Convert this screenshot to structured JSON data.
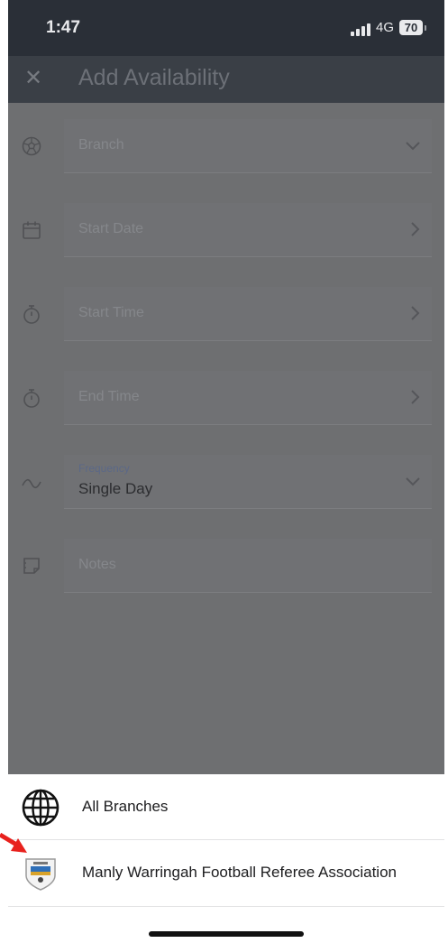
{
  "status_bar": {
    "time": "1:47",
    "network": "4G",
    "battery": "70"
  },
  "header": {
    "close_icon": "close-icon",
    "title": "Add Availability"
  },
  "form": {
    "branch": {
      "placeholder": "Branch",
      "icon": "soccer-ball-icon",
      "chevron": "chevron-down-icon"
    },
    "start_date": {
      "placeholder": "Start Date",
      "icon": "calendar-icon",
      "chevron": "chevron-right-icon"
    },
    "start_time": {
      "placeholder": "Start Time",
      "icon": "stopwatch-icon",
      "chevron": "chevron-right-icon"
    },
    "end_time": {
      "placeholder": "End Time",
      "icon": "stopwatch-icon",
      "chevron": "chevron-right-icon"
    },
    "frequency": {
      "label": "Frequency",
      "value": "Single Day",
      "icon": "wave-icon",
      "chevron": "chevron-down-icon"
    },
    "notes": {
      "placeholder": "Notes",
      "icon": "note-icon"
    }
  },
  "sheet": {
    "options": [
      {
        "label": "All Branches",
        "icon": "globe-icon"
      },
      {
        "label": "Manly Warringah Football Referee Association",
        "icon": "association-logo"
      }
    ]
  },
  "colors": {
    "status_bar_bg": "#2a2f37",
    "overlay": "#6e6f71",
    "sheet_bg": "#ffffff",
    "annotation_arrow": "#e8211d"
  }
}
